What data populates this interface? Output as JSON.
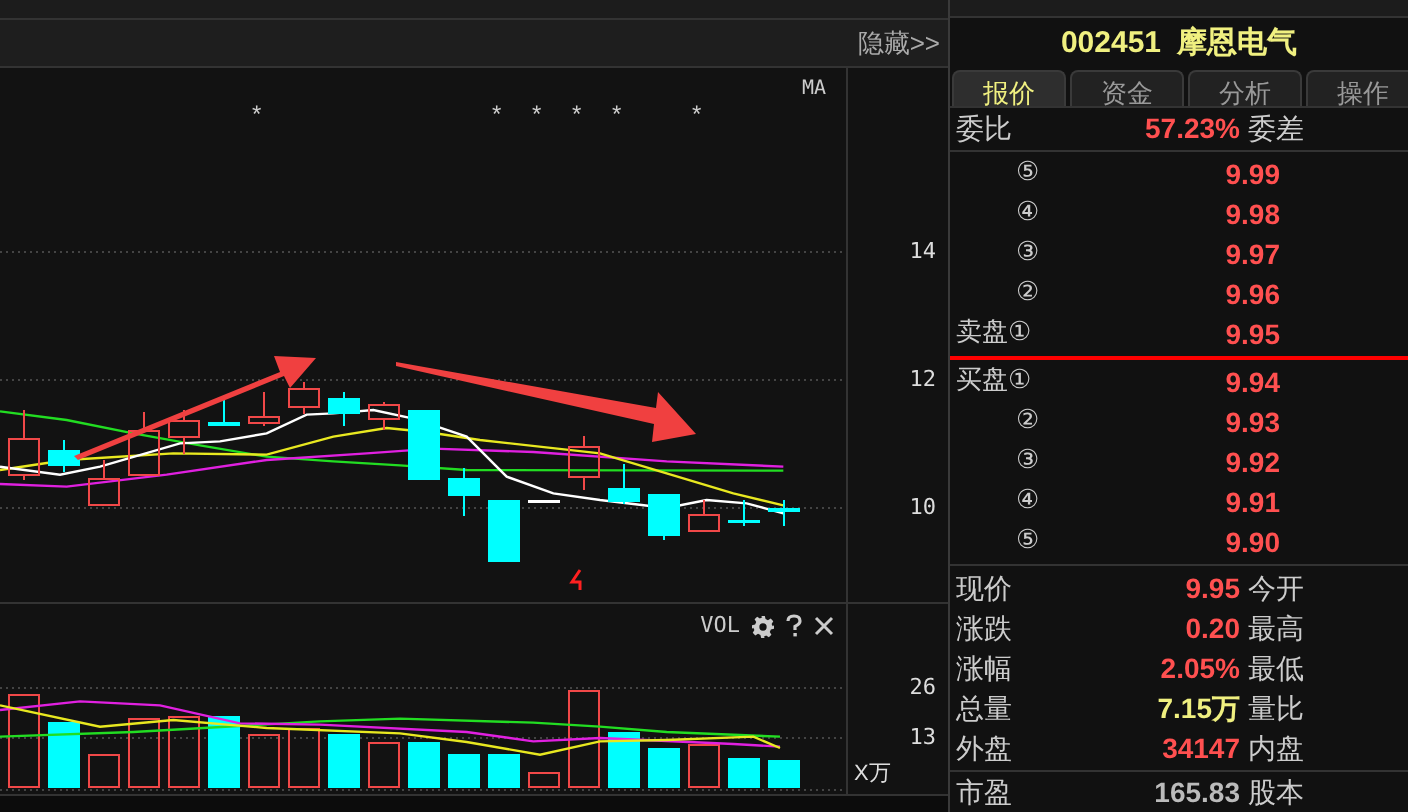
{
  "chart_header": {
    "hide_button": "隐藏>>"
  },
  "price_chart": {
    "indicator": "MA",
    "markers": [
      "*",
      "*",
      "*",
      "*",
      "*",
      "*"
    ],
    "axis_labels": [
      "14",
      "12",
      "10"
    ]
  },
  "volume_chart": {
    "title": "VOL",
    "axis_labels": [
      "26",
      "13"
    ],
    "unit": "X万"
  },
  "quote": {
    "code": "002451",
    "name": "摩恩电气",
    "tabs": [
      {
        "label": "报价",
        "selected": true
      },
      {
        "label": "资金",
        "selected": false
      },
      {
        "label": "分析",
        "selected": false
      },
      {
        "label": "操作",
        "selected": false
      }
    ],
    "ratio": {
      "label": "委比",
      "value": "57.23%",
      "label_2": "委差"
    },
    "asks": [
      {
        "label": "⑤",
        "price": "9.99"
      },
      {
        "label": "④",
        "price": "9.98"
      },
      {
        "label": "③",
        "price": "9.97"
      },
      {
        "label": "②",
        "price": "9.96"
      },
      {
        "label": "卖盘①",
        "price": "9.95"
      }
    ],
    "bids": [
      {
        "label": "买盘①",
        "price": "9.94"
      },
      {
        "label": "②",
        "price": "9.93"
      },
      {
        "label": "③",
        "price": "9.92"
      },
      {
        "label": "④",
        "price": "9.91"
      },
      {
        "label": "⑤",
        "price": "9.90"
      }
    ],
    "stats": [
      {
        "label": "现价",
        "value": "9.95",
        "label_2": "今开",
        "kind": "rise"
      },
      {
        "label": "涨跌",
        "value": "0.20",
        "label_2": "最高",
        "kind": "rise"
      },
      {
        "label": "涨幅",
        "value": "2.05%",
        "label_2": "最低",
        "kind": "rise"
      },
      {
        "label": "总量",
        "value": "7.15万",
        "label_2": "量比",
        "kind": "volume"
      },
      {
        "label": "外盘",
        "value": "34147",
        "label_2": "内盘",
        "kind": "rise"
      }
    ],
    "footer_stats": [
      {
        "label": "市盈",
        "value": "165.83",
        "label_2": "股本",
        "kind": "plain"
      }
    ]
  }
}
